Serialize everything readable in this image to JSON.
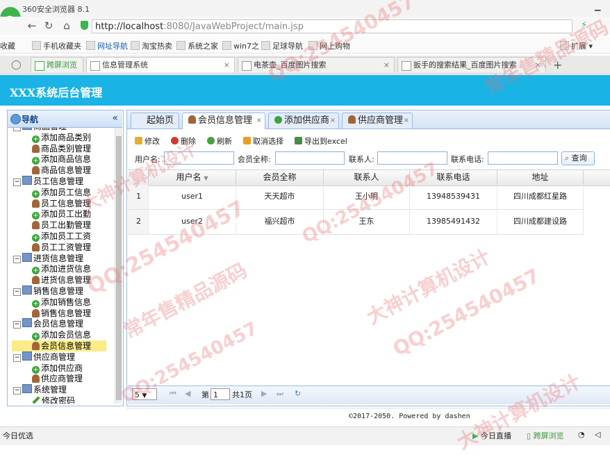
{
  "browser": {
    "title": "360安全浏览器 8.1",
    "url_host": "http://localhost",
    "url_rest": ":8080/JavaWebProject/main.jsp",
    "bookmarks": [
      "收藏",
      "手机收藏夹",
      "网址导航",
      "淘宝热卖",
      "系统之家",
      "win7之",
      "足球导航",
      "网上购物"
    ],
    "extensions": "扩展",
    "tabs": [
      "跨屏浏览",
      "信息管理系统",
      "电茶壶_百度图片搜索",
      "扳手的搜索结果_百度图片搜索"
    ]
  },
  "app": {
    "header": "XXX系统后台管理",
    "nav_title": "导航",
    "nav_collapse": "«",
    "tree": [
      {
        "label": "商品管理",
        "type": "group"
      },
      {
        "label": "添加商品类别",
        "type": "add"
      },
      {
        "label": "商品类别管理",
        "type": "manage"
      },
      {
        "label": "添加商品信息",
        "type": "add"
      },
      {
        "label": "商品信息管理",
        "type": "manage"
      },
      {
        "label": "员工信息管理",
        "type": "group"
      },
      {
        "label": "添加员工信息",
        "type": "add"
      },
      {
        "label": "员工信息管理",
        "type": "manage"
      },
      {
        "label": "添加员工出勤",
        "type": "add"
      },
      {
        "label": "员工出勤管理",
        "type": "manage"
      },
      {
        "label": "添加员工工资",
        "type": "add"
      },
      {
        "label": "员工工资管理",
        "type": "manage"
      },
      {
        "label": "进货信息管理",
        "type": "group"
      },
      {
        "label": "添加进货信息",
        "type": "add"
      },
      {
        "label": "进货信息管理",
        "type": "manage"
      },
      {
        "label": "销售信息管理",
        "type": "group"
      },
      {
        "label": "添加销售信息",
        "type": "add"
      },
      {
        "label": "销售信息管理",
        "type": "manage"
      },
      {
        "label": "会员信息管理",
        "type": "group"
      },
      {
        "label": "添加会员信息",
        "type": "add"
      },
      {
        "label": "会员信息管理",
        "type": "manage",
        "selected": true
      },
      {
        "label": "供应商管理",
        "type": "group"
      },
      {
        "label": "添加供应商",
        "type": "add"
      },
      {
        "label": "供应商管理",
        "type": "manage"
      },
      {
        "label": "系统管理",
        "type": "group"
      },
      {
        "label": "修改密码",
        "type": "edit"
      }
    ],
    "tabs": [
      "起始页",
      "会员信息管理",
      "添加供应商",
      "供应商管理"
    ],
    "toolbar": [
      "修改",
      "删除",
      "刷新",
      "取消选择",
      "导出到excel"
    ],
    "filters": {
      "username": "用户名:",
      "fullname": "会员全称:",
      "contact": "联系人:",
      "phone": "联系电话:",
      "search": "查询"
    },
    "grid": {
      "columns": [
        "用户名",
        "会员全称",
        "联系人",
        "联系电话",
        "地址"
      ],
      "rows": [
        {
          "no": "1",
          "username": "user1",
          "fullname": "天天超市",
          "contact": "王小明",
          "phone": "13948539431",
          "address": "四川成都红星路"
        },
        {
          "no": "2",
          "username": "user2",
          "fullname": "福兴超市",
          "contact": "王东",
          "phone": "13985491432",
          "address": "四川成都建设路"
        }
      ]
    },
    "pager": {
      "page_size": "5",
      "page_label": "第",
      "page_value": "1",
      "total": "共1页"
    },
    "footer": "©2017-2050. Powered by dashen"
  },
  "status": {
    "left": "今日优选",
    "live": "今日直播",
    "cross": "跨屏浏览"
  },
  "watermarks": [
    "QQ:254540457",
    "常年售精品源码",
    "大神计算机设计"
  ]
}
